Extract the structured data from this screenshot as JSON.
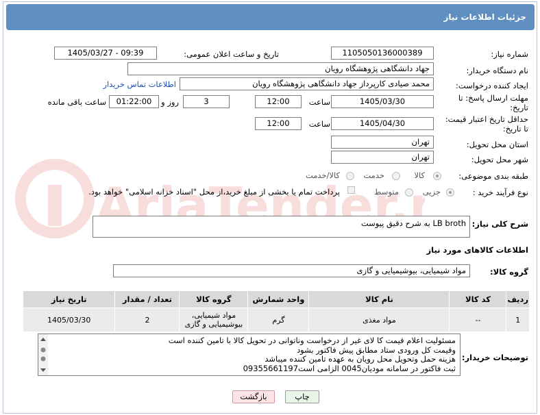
{
  "header": {
    "title": "جزئیات اطلاعات نیاز"
  },
  "fields": {
    "need_number_label": "شماره نیاز:",
    "need_number": "1105050136000389",
    "announce_label": "تاریخ و ساعت اعلان عمومی:",
    "announce_value": "1405/03/27 - 09:39",
    "buyer_org_label": "نام دستگاه خریدار:",
    "buyer_org": "جهاد دانشگاهی پژوهشگاه رویان",
    "creator_label": "ایجاد کننده درخواست:",
    "creator": "محمد صیادی کارپرداز جهاد دانشگاهی پژوهشگاه رویان",
    "contact_link": "اطلاعات تماس خریدار",
    "deadline_label_1": "مهلت ارسال پاسخ: تا",
    "deadline_label_2": "تاریخ:",
    "deadline_date": "1405/03/30",
    "time_label": "ساعت",
    "deadline_time": "12:00",
    "days_value": "3",
    "days_label": "روز و",
    "remaining_time": "01:22:00",
    "remaining_label": "ساعت باقی مانده",
    "price_valid_label_1": "حداقل تاریخ اعتبار قیمت:",
    "price_valid_label_2": "تا تاریخ:",
    "price_valid_date": "1405/04/30",
    "price_valid_time": "12:00",
    "province_label": "استان محل تحویل:",
    "province": "تهران",
    "city_label": "شهر محل تحویل:",
    "city": "تهران",
    "category_label": "طبقه بندی موضوعی:",
    "category_goods": "کالا",
    "category_service": "خدمت",
    "category_both": "کالا/خدمت",
    "process_label": "نوع فرآیند خرید :",
    "process_partial": "جزیی",
    "process_medium": "متوسط",
    "payment_note": "پرداخت تمام یا بخشی از مبلغ خرید،از محل \"اسناد خزانه اسلامی\" خواهد بود.",
    "general_desc_label": "شرح کلی نیاز:",
    "general_desc": "LB broth به شرح دقیق پیوست"
  },
  "goods": {
    "section_title": "اطلاعات کالاهای مورد نیاز",
    "group_label": "گروه کالا:",
    "group_value": "مواد شیمیایی، بیوشیمیایی و  گازی",
    "columns": [
      "ردیف",
      "کد کالا",
      "نام کالا",
      "واحد شمارش",
      "گروه کالا",
      "تعداد / مقدار",
      "تاریخ نیاز"
    ],
    "rows": [
      {
        "row": "1",
        "code": "--",
        "name": "مواد مغذی",
        "unit": "گرم",
        "group_line1": "مواد شیمیایی،",
        "group_line2": "بیوشیمیایی و گازی",
        "qty": "2",
        "date": "1405/03/30"
      }
    ]
  },
  "buyer_notes": {
    "label": "توضیحات خریدار:",
    "lines": [
      "مسئولیت اعلام قیمت کا لای  غیر از درخواست وناتوانی در تحویل کالا با تامین کننده است",
      "وقیمت کل ورودی ستاد مطابق پیش فاکتور بشود",
      "هزینه حمل وتحویل محل رویان به عهده تامین کننده میباشد",
      "ثبت فاکتور در سامانه مودیان0045 الزامی است09355661197"
    ]
  },
  "buttons": {
    "print": "چاپ",
    "back": "بازگشت"
  },
  "watermark": "AriaTender.net"
}
